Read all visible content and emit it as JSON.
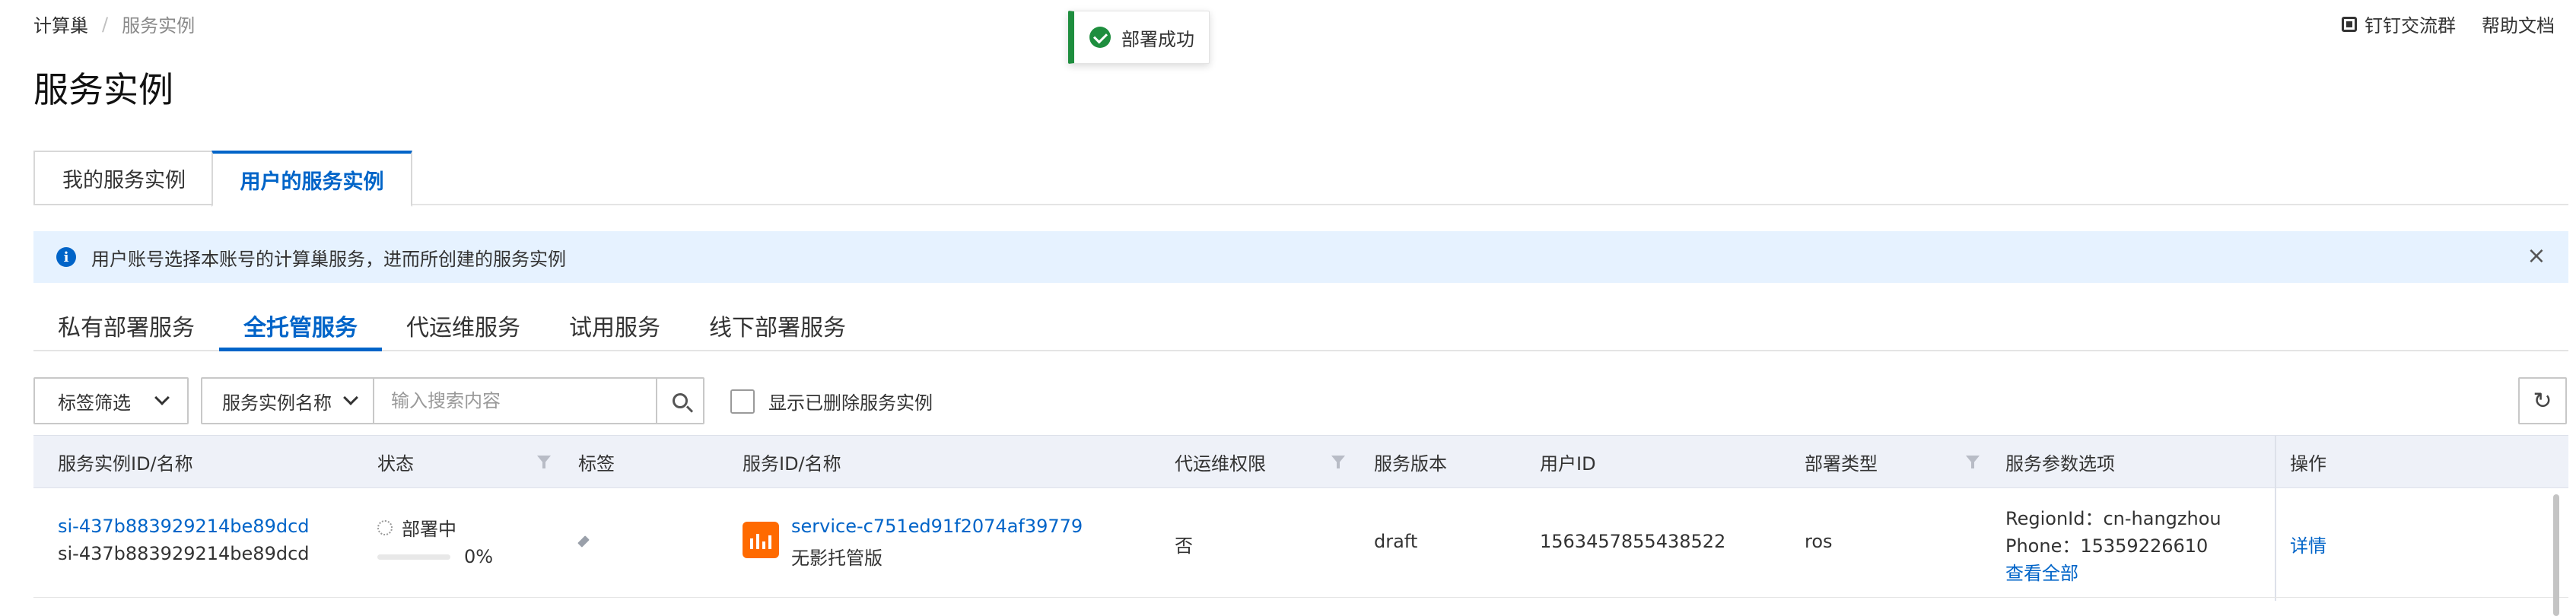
{
  "breadcrumb": {
    "root": "计算巢",
    "separator": "/",
    "current": "服务实例"
  },
  "top_links": {
    "dingtalk": "钉钉交流群",
    "help": "帮助文档"
  },
  "toast": {
    "message": "部署成功"
  },
  "page_title": "服务实例",
  "main_tabs": [
    {
      "label": "我的服务实例",
      "active": false
    },
    {
      "label": "用户的服务实例",
      "active": true
    }
  ],
  "banner": {
    "text": "用户账号选择本账号的计算巢服务，进而所创建的服务实例",
    "close": "×"
  },
  "sub_tabs": [
    {
      "label": "私有部署服务",
      "active": false
    },
    {
      "label": "全托管服务",
      "active": true
    },
    {
      "label": "代运维服务",
      "active": false
    },
    {
      "label": "试用服务",
      "active": false
    },
    {
      "label": "线下部署服务",
      "active": false
    }
  ],
  "toolbar": {
    "tag_filter": "标签筛选",
    "search_field": "服务实例名称",
    "search_placeholder": "输入搜索内容",
    "show_deleted": "显示已删除服务实例",
    "show_deleted_checked": false
  },
  "table": {
    "headers": {
      "instance": "服务实例ID/名称",
      "status": "状态",
      "tags": "标签",
      "service": "服务ID/名称",
      "ops_permission": "代运维权限",
      "version": "服务版本",
      "user_id": "用户ID",
      "deploy_type": "部署类型",
      "params": "服务参数选项",
      "actions": "操作"
    },
    "rows": [
      {
        "instance_id": "si-437b883929214be89dcd",
        "instance_name": "si-437b883929214be89dcd",
        "status": "部署中",
        "progress": "0%",
        "service_id": "service-c751ed91f2074af39779",
        "service_name": "无影托管版",
        "ops_permission": "否",
        "version": "draft",
        "user_id": "1563457855438522",
        "deploy_type": "ros",
        "param_region": "RegionId：cn-hangzhou",
        "param_phone": "Phone：15359226610",
        "param_more": "查看全部",
        "action": "详情"
      }
    ]
  },
  "colors": {
    "accent": "#0064c8",
    "success": "#1e8e3e",
    "banner_bg": "#e6f2ff",
    "header_bg": "#eef1f8",
    "logo": "#ff6a00"
  }
}
